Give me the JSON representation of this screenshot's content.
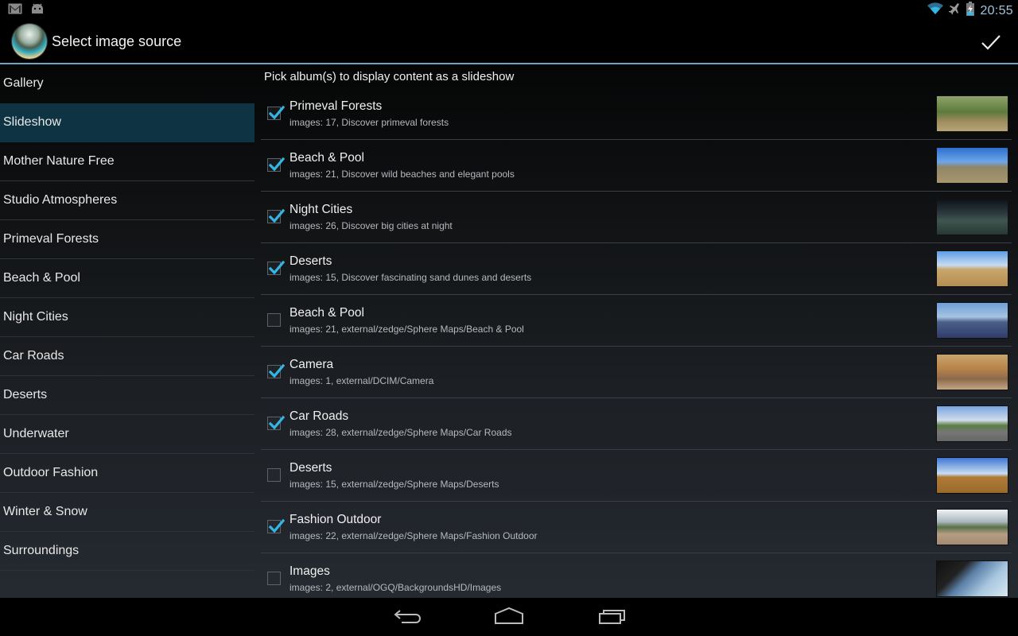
{
  "status_bar": {
    "left_icons": [
      "gmail-icon",
      "android-icon"
    ],
    "right_icons": [
      "wifi-icon",
      "airplane-mode-icon",
      "battery-charging-icon"
    ],
    "time": "20:55"
  },
  "action_bar": {
    "title": "Select image source",
    "confirm_icon": "checkmark-icon",
    "accent_color": "#6aa6c8"
  },
  "sidebar": {
    "selected_index": 1,
    "selected_color": "#0e3444",
    "items": [
      {
        "label": "Gallery"
      },
      {
        "label": "Slideshow"
      },
      {
        "label": "Mother Nature Free"
      },
      {
        "label": "Studio Atmospheres"
      },
      {
        "label": "Primeval Forests"
      },
      {
        "label": "Beach & Pool"
      },
      {
        "label": "Night Cities"
      },
      {
        "label": "Car Roads"
      },
      {
        "label": "Deserts"
      },
      {
        "label": "Underwater"
      },
      {
        "label": "Outdoor Fashion"
      },
      {
        "label": "Winter & Snow"
      },
      {
        "label": "Surroundings"
      }
    ]
  },
  "main": {
    "heading": "Pick album(s) to display content as a slideshow",
    "check_color": "#33b5e5",
    "albums": [
      {
        "title": "Primeval Forests",
        "subtitle": "images: 17, Discover primeval forests",
        "checked": true,
        "thumb": "forest"
      },
      {
        "title": "Beach & Pool",
        "subtitle": "images: 21, Discover wild beaches and elegant pools",
        "checked": true,
        "thumb": "beach"
      },
      {
        "title": "Night Cities",
        "subtitle": "images: 26, Discover big cities at night",
        "checked": true,
        "thumb": "night"
      },
      {
        "title": "Deserts",
        "subtitle": "images: 15, Discover fascinating sand dunes and deserts",
        "checked": true,
        "thumb": "desert"
      },
      {
        "title": "Beach & Pool",
        "subtitle": "images: 21, external/zedge/Sphere Maps/Beach & Pool",
        "checked": false,
        "thumb": "beach2"
      },
      {
        "title": "Camera",
        "subtitle": "images: 1, external/DCIM/Camera",
        "checked": true,
        "thumb": "room"
      },
      {
        "title": "Car Roads",
        "subtitle": "images: 28, external/zedge/Sphere Maps/Car Roads",
        "checked": true,
        "thumb": "road"
      },
      {
        "title": "Deserts",
        "subtitle": "images: 15, external/zedge/Sphere Maps/Deserts",
        "checked": false,
        "thumb": "desert2"
      },
      {
        "title": "Fashion Outdoor",
        "subtitle": "images: 22, external/zedge/Sphere Maps/Fashion Outdoor",
        "checked": true,
        "thumb": "fashion"
      },
      {
        "title": "Images",
        "subtitle": "images: 2, external/OGQ/BackgroundsHD/Images",
        "checked": false,
        "thumb": "coast"
      }
    ]
  },
  "nav_bar": {
    "buttons": [
      "back-icon",
      "home-icon",
      "recent-apps-icon"
    ]
  }
}
